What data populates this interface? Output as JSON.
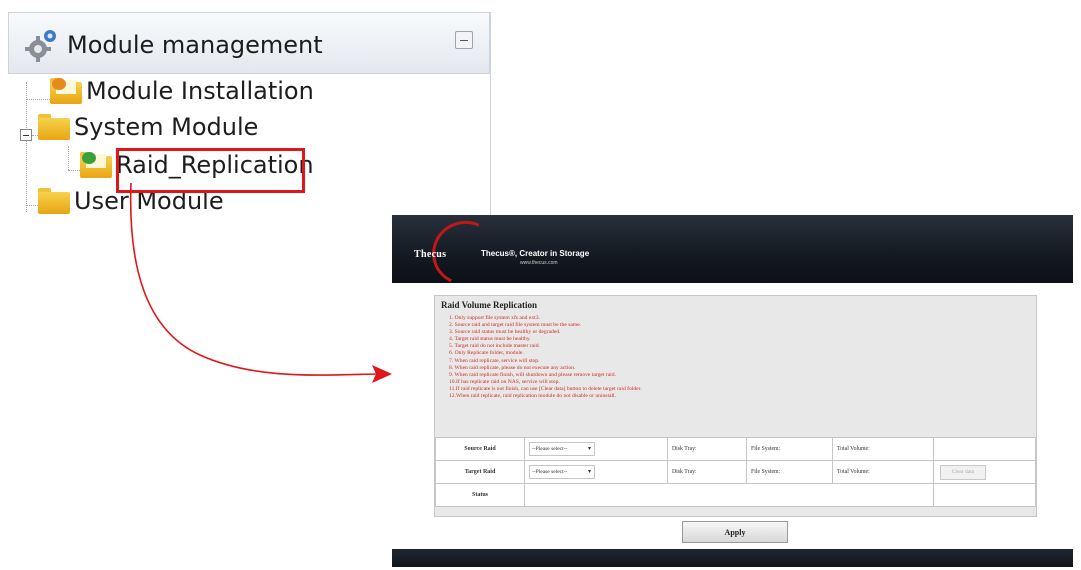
{
  "tree": {
    "title": "Module management",
    "items": [
      {
        "label": "Module Installation"
      },
      {
        "label": "System Module"
      },
      {
        "label": "Raid_Replication"
      },
      {
        "label": "User Module"
      }
    ]
  },
  "window": {
    "brand": "Thecus",
    "tagline": "Thecus®, Creator in Storage",
    "website": "www.thecus.com",
    "section_title": "Raid Volume Replication",
    "notes": [
      "1. Only support file system xfs and ext3.",
      "2. Source raid and target raid file system must be the same.",
      "3. Source raid status must be healthy or degraded.",
      "4. Target raid status must be healthy.",
      "5. Target raid do not include master raid.",
      "6. Only Replicate folder, module.",
      "7. When raid replicate, service will stop.",
      "8. When raid replicate, please do not execute any action.",
      "9. When raid replicate finish, will shutdown and please remove target raid.",
      "10.If has replicate raid on NAS, service will stop.",
      "11.If raid replicate is not finish, can use [Clear data] button to delete target raid folder.",
      "12.When raid replicate, raid replication module do not disable or uninstall."
    ],
    "form": {
      "source_label": "Source Raid",
      "target_label": "Target Raid",
      "status_label": "Status",
      "select_placeholder": "--Please select--",
      "disk_tray_label": "Disk Tray:",
      "file_system_label": "File System:",
      "total_volume_label": "Total Volume:",
      "clear_data_label": "Clear data"
    },
    "apply_label": "Apply"
  },
  "colors": {
    "highlight": "#e0161b",
    "notes_text": "#cf2a22",
    "header_dark": "#141a22"
  }
}
